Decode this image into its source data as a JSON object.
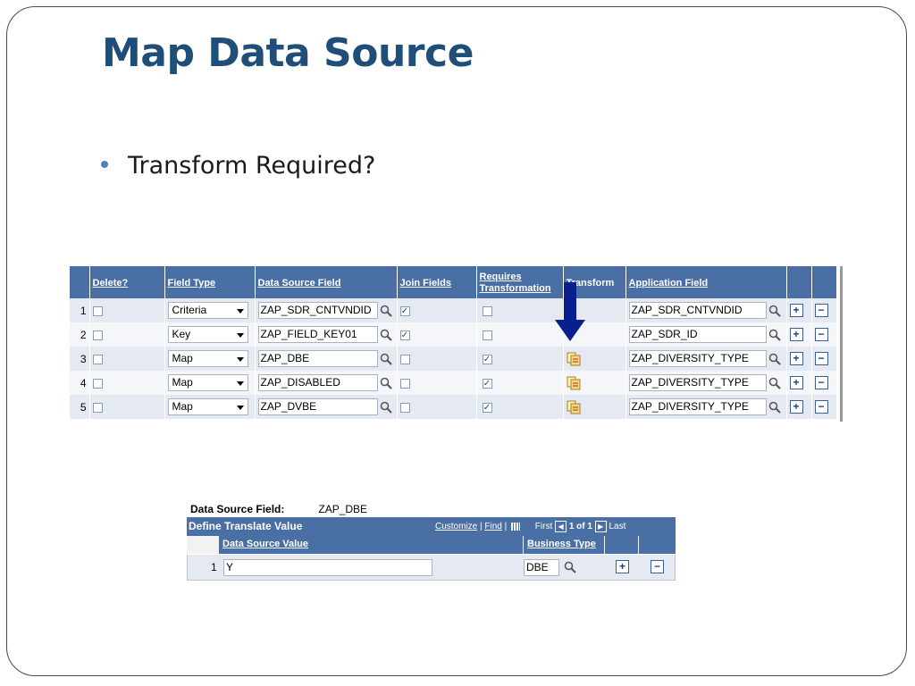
{
  "slide": {
    "title": "Map Data Source",
    "bullet": "Transform Required?"
  },
  "grid": {
    "headers": {
      "delete": "Delete?",
      "field_type": "Field Type",
      "data_source_field": "Data Source Field",
      "join_fields": "Join Fields",
      "requires_transformation": "Requires Transformation",
      "transform": "Transform",
      "application_field": "Application Field"
    },
    "rows": [
      {
        "num": "1",
        "field_type": "Criteria",
        "data_source_field": "ZAP_SDR_CNTVNDID",
        "join_checked": true,
        "req_checked": false,
        "application_field": "ZAP_SDR_CNTVNDID"
      },
      {
        "num": "2",
        "field_type": "Key",
        "data_source_field": "ZAP_FIELD_KEY01",
        "join_checked": true,
        "req_checked": false,
        "application_field": "ZAP_SDR_ID"
      },
      {
        "num": "3",
        "field_type": "Map",
        "data_source_field": "ZAP_DBE",
        "join_checked": false,
        "req_checked": true,
        "application_field": "ZAP_DIVERSITY_TYPE"
      },
      {
        "num": "4",
        "field_type": "Map",
        "data_source_field": "ZAP_DISABLED",
        "join_checked": false,
        "req_checked": true,
        "application_field": "ZAP_DIVERSITY_TYPE"
      },
      {
        "num": "5",
        "field_type": "Map",
        "data_source_field": "ZAP_DVBE",
        "join_checked": false,
        "req_checked": true,
        "application_field": "ZAP_DIVERSITY_TYPE"
      }
    ],
    "arrow_color": "#0a1f8f",
    "header_color": "#4a6fa5"
  },
  "translate": {
    "dsf_label": "Data Source Field:",
    "dsf_value": "ZAP_DBE",
    "section_title": "Define Translate Value",
    "customize": "Customize",
    "find": "Find",
    "first": "First",
    "range": "1 of 1",
    "last": "Last",
    "col_value": "Data Source Value",
    "col_business": "Business Type",
    "row_num": "1",
    "row_value": "Y",
    "row_business": "DBE"
  }
}
